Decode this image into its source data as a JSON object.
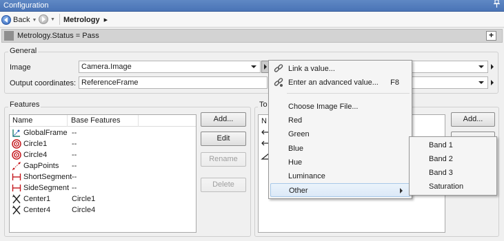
{
  "window": {
    "title": "Configuration",
    "pin_icon": "pin-icon"
  },
  "toolbar": {
    "back_label": "Back",
    "breadcrumb": "Metrology",
    "breadcrumb_arrow": "▸"
  },
  "status": {
    "text": "Metrology.Status = Pass",
    "expand_label": "+"
  },
  "general": {
    "legend": "General",
    "image_label": "Image",
    "image_value": "Camera.Image",
    "output_label": "Output coordinates:",
    "output_value": "ReferenceFrame"
  },
  "features": {
    "legend": "Features",
    "columns": [
      "Name",
      "Base Features"
    ],
    "rows": [
      {
        "name": "GlobalFrame",
        "base": "--",
        "icon": "frame-icon"
      },
      {
        "name": "Circle1",
        "base": "--",
        "icon": "circle-target-icon"
      },
      {
        "name": "Circle4",
        "base": "--",
        "icon": "circle-target-icon"
      },
      {
        "name": "GapPoints",
        "base": "--",
        "icon": "gap-points-icon"
      },
      {
        "name": "ShortSegment",
        "base": "--",
        "icon": "segment-icon"
      },
      {
        "name": "SideSegment",
        "base": "--",
        "icon": "segment-icon"
      },
      {
        "name": "Center1",
        "base": "Circle1",
        "icon": "center-icon"
      },
      {
        "name": "Center4",
        "base": "Circle4",
        "icon": "center-icon"
      }
    ],
    "buttons": {
      "add": "Add...",
      "edit": "Edit",
      "rename": "Rename",
      "delete": "Delete"
    }
  },
  "tolerances": {
    "legend_partial": "To",
    "col_partial": "N",
    "add_button": "Add..."
  },
  "context_menu": {
    "items": [
      {
        "label": "Link a value...",
        "icon": "link-icon",
        "shortcut": ""
      },
      {
        "label": "Enter an advanced value...",
        "icon": "link-advanced-icon",
        "shortcut": "F8"
      },
      {
        "label": "Choose Image File...",
        "icon": "",
        "shortcut": ""
      },
      {
        "label": "Red"
      },
      {
        "label": "Green"
      },
      {
        "label": "Blue"
      },
      {
        "label": "Hue"
      },
      {
        "label": "Luminance"
      },
      {
        "label": "Other"
      }
    ]
  },
  "submenu": {
    "items": [
      {
        "label": "Band 1"
      },
      {
        "label": "Band 2"
      },
      {
        "label": "Band 3"
      },
      {
        "label": "Saturation"
      }
    ]
  }
}
